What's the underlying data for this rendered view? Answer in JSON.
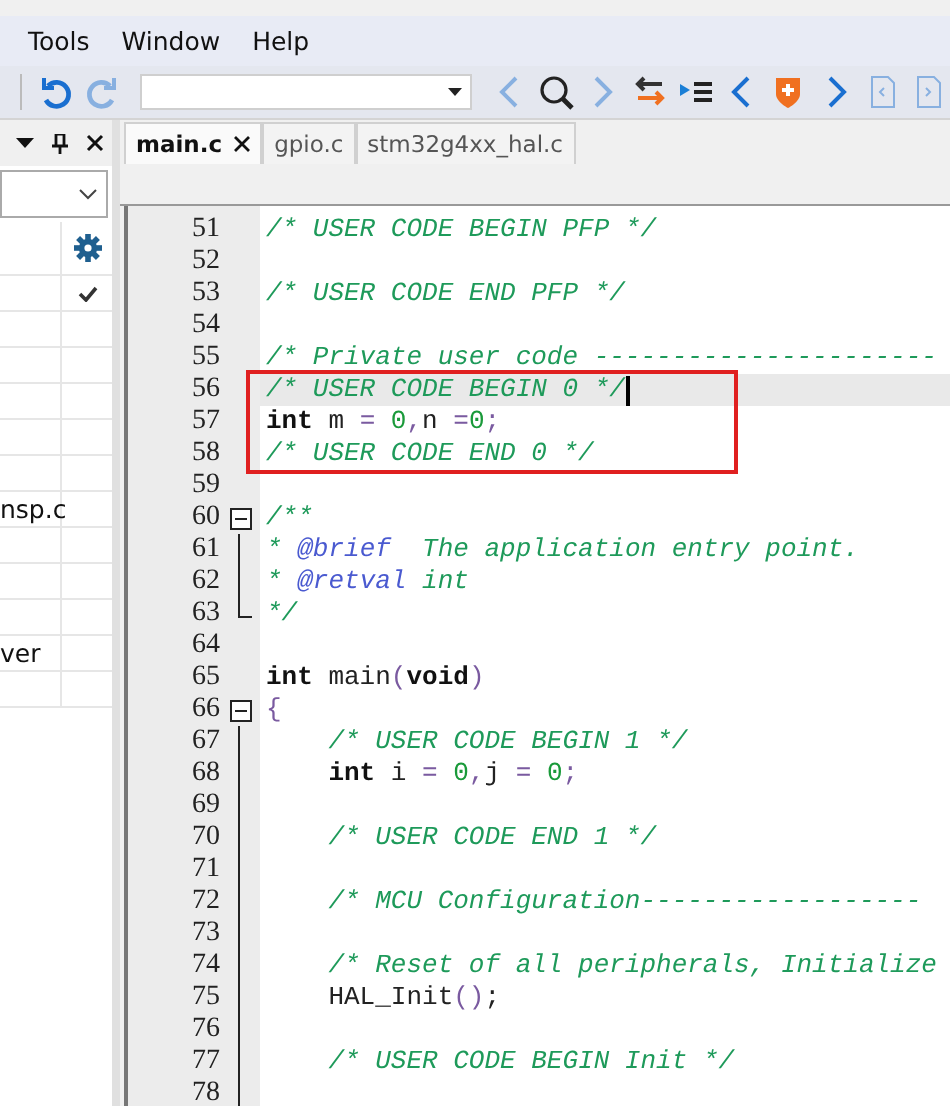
{
  "menu": [
    {
      "label": "Tools"
    },
    {
      "label": "Window"
    },
    {
      "label": "Help"
    }
  ],
  "toolbar": [
    {
      "kind": "undo",
      "disabled": false
    },
    {
      "kind": "redo",
      "disabled": true
    },
    {
      "kind": "combo",
      "disabled": false
    },
    {
      "kind": "back",
      "disabled": true
    },
    {
      "kind": "search",
      "disabled": false
    },
    {
      "kind": "forward",
      "disabled": true
    },
    {
      "kind": "swap",
      "disabled": false
    },
    {
      "kind": "outline",
      "disabled": false
    },
    {
      "kind": "prev",
      "disabled": false
    },
    {
      "kind": "bookmark",
      "disabled": false
    },
    {
      "kind": "next",
      "disabled": false
    },
    {
      "kind": "page-prev",
      "disabled": true
    },
    {
      "kind": "page-next",
      "disabled": true
    }
  ],
  "left_panel": {
    "rows": [
      {
        "kind": "settings"
      },
      {
        "kind": "check"
      },
      {
        "kind": "empty"
      },
      {
        "kind": "empty"
      },
      {
        "kind": "empty"
      },
      {
        "kind": "empty"
      },
      {
        "kind": "empty"
      },
      {
        "kind": "file",
        "label": "nsp.c"
      },
      {
        "kind": "empty"
      },
      {
        "kind": "empty"
      },
      {
        "kind": "empty"
      },
      {
        "kind": "file",
        "label": "ver"
      },
      {
        "kind": "empty"
      }
    ]
  },
  "tabs": [
    {
      "label": "main.c",
      "selected": true
    },
    {
      "label": "gpio.c",
      "selected": false
    },
    {
      "label": "stm32g4xx_hal.c",
      "selected": false
    }
  ],
  "editor": {
    "lines": [
      {
        "number": "51",
        "kind": "plain",
        "active": false,
        "tokens": [
          {
            "text": "/* USER CODE BEGIN PFP */",
            "kind": "comment"
          }
        ]
      },
      {
        "number": "52",
        "kind": "plain",
        "active": false
      },
      {
        "number": "53",
        "kind": "plain",
        "active": false,
        "tokens": [
          {
            "text": "/* USER CODE END PFP */",
            "kind": "comment"
          }
        ]
      },
      {
        "number": "54",
        "kind": "plain",
        "active": false
      },
      {
        "number": "55",
        "kind": "plain",
        "active": false,
        "tokens": [
          {
            "text": "/* Private user code ----------------------",
            "kind": "comment"
          }
        ]
      },
      {
        "kind": "highlight-group",
        "lines": [
          {
            "number": "56",
            "active": true,
            "tokens": [
              {
                "text": "/* USER CODE BEGIN 0 */",
                "kind": "comment"
              }
            ]
          },
          {
            "number": "57",
            "active": false,
            "tokens": [
              {
                "text": "int",
                "kind": "keyword"
              },
              {
                "text": " m ",
                "kind": "plain"
              },
              {
                "text": "= ",
                "kind": "operator"
              },
              {
                "text": "0",
                "kind": "number"
              },
              {
                "text": ",",
                "kind": "operator"
              },
              {
                "text": "n ",
                "kind": "plain"
              },
              {
                "text": "=",
                "kind": "operator"
              },
              {
                "text": "0",
                "kind": "number"
              },
              {
                "text": ";",
                "kind": "operator"
              }
            ]
          },
          {
            "number": "58",
            "active": false,
            "tokens": [
              {
                "text": "/* USER CODE END 0 */",
                "kind": "comment"
              }
            ]
          }
        ]
      },
      {
        "number": "59",
        "kind": "plain",
        "active": false
      },
      {
        "number": "60",
        "kind": "fold-start",
        "active": false,
        "tokens": [
          {
            "text": "/**",
            "kind": "comment"
          }
        ]
      },
      {
        "number": "61",
        "kind": "fold-body",
        "active": false,
        "tokens": [
          {
            "text": "* ",
            "kind": "comment"
          },
          {
            "text": "@brief",
            "kind": "doctag"
          },
          {
            "text": "  The application entry point.",
            "kind": "comment"
          }
        ]
      },
      {
        "number": "62",
        "kind": "fold-body",
        "active": false,
        "tokens": [
          {
            "text": "* ",
            "kind": "comment"
          },
          {
            "text": "@retval",
            "kind": "doctag"
          },
          {
            "text": " int",
            "kind": "comment"
          }
        ]
      },
      {
        "number": "63",
        "kind": "fold-end",
        "active": false,
        "tokens": [
          {
            "text": "*/",
            "kind": "comment"
          }
        ]
      },
      {
        "number": "64",
        "kind": "plain",
        "active": false
      },
      {
        "number": "65",
        "kind": "plain",
        "active": false,
        "tokens": [
          {
            "text": "int",
            "kind": "keyword"
          },
          {
            "text": " main",
            "kind": "plain"
          },
          {
            "text": "(",
            "kind": "operator"
          },
          {
            "text": "void",
            "kind": "keyword"
          },
          {
            "text": ")",
            "kind": "operator"
          }
        ]
      },
      {
        "number": "66",
        "kind": "fold-start",
        "active": false,
        "tokens": [
          {
            "text": "{",
            "kind": "operator"
          }
        ]
      },
      {
        "number": "67",
        "kind": "fold-body",
        "active": false,
        "tokens": [
          {
            "text": "    /* USER CODE BEGIN 1 */",
            "kind": "comment"
          }
        ]
      },
      {
        "number": "68",
        "kind": "fold-body",
        "active": false,
        "tokens": [
          {
            "text": "    int",
            "kind": "keyword"
          },
          {
            "text": " i ",
            "kind": "plain"
          },
          {
            "text": "= ",
            "kind": "operator"
          },
          {
            "text": "0",
            "kind": "number"
          },
          {
            "text": ",",
            "kind": "operator"
          },
          {
            "text": "j ",
            "kind": "plain"
          },
          {
            "text": "= ",
            "kind": "operator"
          },
          {
            "text": "0",
            "kind": "number"
          },
          {
            "text": ";",
            "kind": "operator"
          }
        ]
      },
      {
        "number": "69",
        "kind": "fold-body",
        "active": false
      },
      {
        "number": "70",
        "kind": "fold-body",
        "active": false,
        "tokens": [
          {
            "text": "    /* USER CODE END 1 */",
            "kind": "comment"
          }
        ]
      },
      {
        "number": "71",
        "kind": "fold-body",
        "active": false
      },
      {
        "number": "72",
        "kind": "fold-body",
        "active": false,
        "tokens": [
          {
            "text": "    /* MCU Configuration------------------",
            "kind": "comment"
          }
        ]
      },
      {
        "number": "73",
        "kind": "fold-body",
        "active": false
      },
      {
        "number": "74",
        "kind": "fold-body",
        "active": false,
        "tokens": [
          {
            "text": "    /* Reset of all peripherals, Initialize",
            "kind": "comment"
          }
        ]
      },
      {
        "number": "75",
        "kind": "fold-body",
        "active": false,
        "tokens": [
          {
            "text": "    HAL_Init",
            "kind": "plain"
          },
          {
            "text": "()",
            "kind": "operator"
          },
          {
            "text": ";",
            "kind": "plain"
          }
        ]
      },
      {
        "number": "76",
        "kind": "fold-body",
        "active": false
      },
      {
        "number": "77",
        "kind": "fold-body",
        "active": false,
        "tokens": [
          {
            "text": "    /* USER CODE BEGIN Init */",
            "kind": "comment"
          }
        ]
      },
      {
        "number": "78",
        "kind": "fold-body",
        "active": false
      }
    ]
  }
}
